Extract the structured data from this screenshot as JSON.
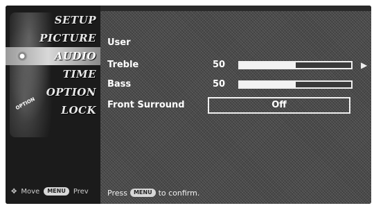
{
  "menu": {
    "items": [
      {
        "label": "SETUP"
      },
      {
        "label": "PICTURE"
      },
      {
        "label": "AUDIO"
      },
      {
        "label": "TIME"
      },
      {
        "label": "OPTION"
      },
      {
        "label": "LOCK"
      }
    ],
    "art_tag": "OPTION"
  },
  "left_footer": {
    "move_icon": "dpad-icon",
    "move_label": "Move",
    "menu_button_label": "MENU",
    "prev_label": "Prev"
  },
  "panel": {
    "mode_label": "User",
    "treble": {
      "label": "Treble",
      "value": "50",
      "level": 0.5
    },
    "bass": {
      "label": "Bass",
      "value": "50",
      "level": 0.5
    },
    "front_surround": {
      "label": "Front Surround",
      "value": "Off"
    },
    "right_arrow": "▶"
  },
  "footer": {
    "prefix": "Press",
    "menu_button_label": "MENU",
    "suffix": "to confirm."
  }
}
